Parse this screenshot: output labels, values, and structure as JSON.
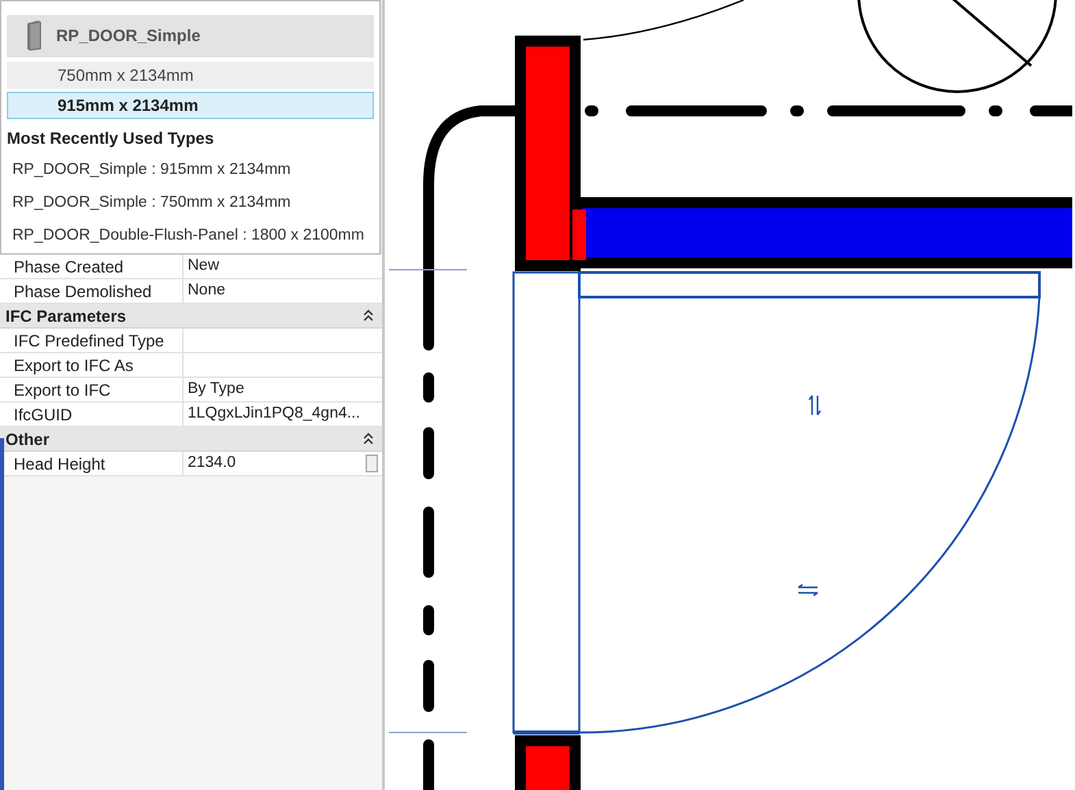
{
  "type_selector": {
    "family": "RP_DOOR_Simple",
    "types": [
      {
        "label": "750mm x 2134mm",
        "selected": false,
        "hovered": true
      },
      {
        "label": "915mm x 2134mm",
        "selected": true,
        "hovered": false
      }
    ],
    "recent_title": "Most Recently Used Types",
    "recent": [
      "RP_DOOR_Simple : 915mm x 2134mm",
      "RP_DOOR_Simple : 750mm x 2134mm",
      "RP_DOOR_Double-Flush-Panel : 1800 x 2100mm"
    ]
  },
  "properties": [
    {
      "kind": "row",
      "label": "Phase Created",
      "value": "New"
    },
    {
      "kind": "row",
      "label": "Phase Demolished",
      "value": "None"
    },
    {
      "kind": "group",
      "label": "IFC Parameters",
      "expanded": true
    },
    {
      "kind": "row",
      "label": "IFC Predefined Type"
    },
    {
      "kind": "row",
      "label": "Export to IFC As"
    },
    {
      "kind": "row",
      "label": "Export to IFC",
      "value": "By Type"
    },
    {
      "kind": "row",
      "label": "IfcGUID",
      "value": "1LQgxLJin1PQ8_4gn4..."
    },
    {
      "kind": "group",
      "label": "Other",
      "expanded": true
    },
    {
      "kind": "editable",
      "label": "Head Height",
      "value": "2134.0"
    }
  ]
}
